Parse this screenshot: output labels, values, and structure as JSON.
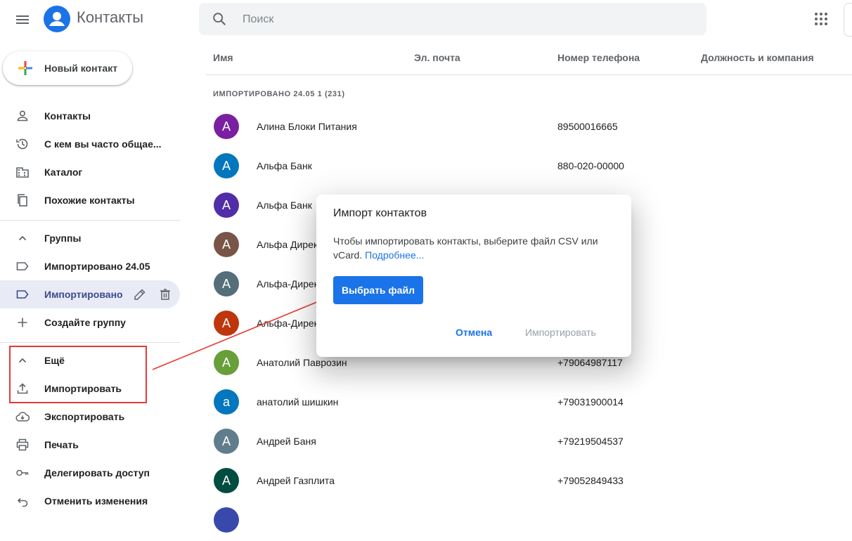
{
  "header": {
    "title": "Контакты",
    "search_placeholder": "Поиск",
    "brand_color": "#1a73e8"
  },
  "sidebar": {
    "new_contact_label": "Новый контакт",
    "items": [
      {
        "label": "Контакты",
        "icon": "person-icon"
      },
      {
        "label": "С кем вы часто общае...",
        "icon": "history-icon"
      },
      {
        "label": "Каталог",
        "icon": "building-icon"
      },
      {
        "label": "Похожие контакты",
        "icon": "copy-icon"
      }
    ],
    "groups_label": "Группы",
    "group_items": [
      {
        "label": "Импортировано 24.05",
        "icon": "label-icon"
      },
      {
        "label": "Импортировано",
        "icon": "label-icon"
      }
    ],
    "create_group_label": "Создайте группу",
    "more_label": "Ещё",
    "more_items": [
      {
        "label": "Импортировать",
        "icon": "upload-icon"
      },
      {
        "label": "Экспортировать",
        "icon": "cloud-download-icon"
      },
      {
        "label": "Печать",
        "icon": "print-icon"
      },
      {
        "label": "Делегировать доступ",
        "icon": "key-icon"
      },
      {
        "label": "Отменить изменения",
        "icon": "undo-icon"
      }
    ]
  },
  "table": {
    "columns": [
      "Имя",
      "Эл. почта",
      "Номер телефона",
      "Должность и компания"
    ],
    "group_header": "ИМПОРТИРОВАНО 24.05 1 (231)",
    "rows": [
      {
        "initial": "А",
        "name": "Алина Блоки Питания",
        "phone": "89500016665",
        "color": "#7b1fa2"
      },
      {
        "initial": "А",
        "name": "Альфа Банк",
        "phone": "880-020-00000",
        "color": "#0277bd"
      },
      {
        "initial": "А",
        "name": "Альфа Банк",
        "phone": "",
        "color": "#512da8"
      },
      {
        "initial": "А",
        "name": "Альфа Дирек",
        "phone": "",
        "color": "#795548"
      },
      {
        "initial": "А",
        "name": "Альфа-Дирек",
        "phone": "",
        "color": "#546e7a"
      },
      {
        "initial": "А",
        "name": "Альфа-Дирек",
        "phone": "",
        "color": "#bf360c"
      },
      {
        "initial": "А",
        "name": "Анатолий Паврозин",
        "phone": "+79064987117",
        "color": "#689f38"
      },
      {
        "initial": "а",
        "name": "анатолий шишкин",
        "phone": "+79031900014",
        "color": "#0277bd"
      },
      {
        "initial": "А",
        "name": "Андрей Баня",
        "phone": "+79219504537",
        "color": "#607d8b"
      },
      {
        "initial": "А",
        "name": "Андрей Газплита",
        "phone": "+79052849433",
        "color": "#004d40"
      }
    ]
  },
  "dialog": {
    "title": "Импорт контактов",
    "text": "Чтобы импортировать контакты, выберите файл CSV или vCard.",
    "link": "Подробнее...",
    "choose_button": "Выбрать файл",
    "cancel_button": "Отмена",
    "import_button": "Импортировать"
  }
}
